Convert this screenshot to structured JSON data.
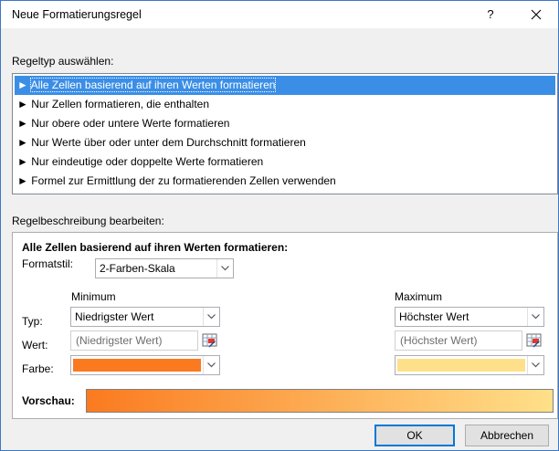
{
  "dialog": {
    "title": "Neue Formatierungsregel",
    "help_label": "?",
    "close_label": "✕"
  },
  "rule_type": {
    "label": "Regeltyp auswählen:",
    "items": [
      {
        "label": "Alle Zellen basierend auf ihren Werten formatieren",
        "selected": true
      },
      {
        "label": "Nur Zellen formatieren, die enthalten",
        "selected": false
      },
      {
        "label": "Nur obere oder untere Werte formatieren",
        "selected": false
      },
      {
        "label": "Nur Werte über oder unter dem Durchschnitt formatieren",
        "selected": false
      },
      {
        "label": "Nur eindeutige oder doppelte Werte formatieren",
        "selected": false
      },
      {
        "label": "Formel zur Ermittlung der zu formatierenden Zellen verwenden",
        "selected": false
      }
    ],
    "bullet": "►"
  },
  "description": {
    "label": "Regelbeschreibung bearbeiten:",
    "heading": "Alle Zellen basierend auf ihren Werten formatieren:",
    "format_style_label": "Formatstil:",
    "format_style_value": "2-Farben-Skala",
    "minimum_label": "Minimum",
    "maximum_label": "Maximum",
    "type_label": "Typ:",
    "value_label": "Wert:",
    "color_label": "Farbe:",
    "min_type": "Niedrigster Wert",
    "max_type": "Höchster Wert",
    "min_value": "(Niedrigster Wert)",
    "max_value": "(Höchster Wert)",
    "min_color": "#fb7a1f",
    "max_color": "#ffe08a",
    "preview_label": "Vorschau:"
  },
  "buttons": {
    "ok": "OK",
    "cancel": "Abbrechen"
  },
  "icons": {
    "cell_reference": "cell-reference-icon",
    "dropdown_arrow": "chevron-down-icon"
  }
}
